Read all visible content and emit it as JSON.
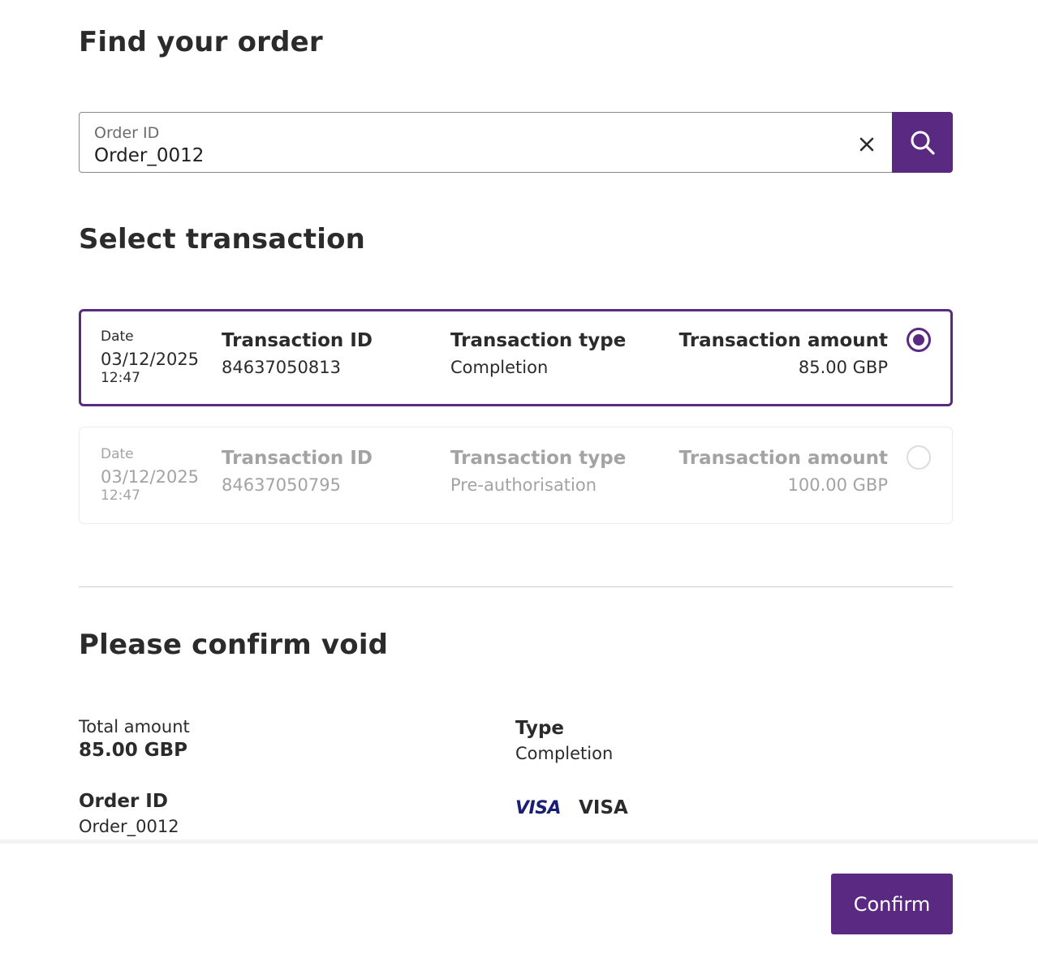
{
  "find_order": {
    "title": "Find your order",
    "field_label": "Order ID",
    "field_value": "Order_0012"
  },
  "select_transaction": {
    "title": "Select transaction",
    "transactions": [
      {
        "date_label": "Date",
        "date": "03/12/2025",
        "time": "12:47",
        "id_label": "Transaction ID",
        "id": "84637050813",
        "type_label": "Transaction type",
        "type": "Completion",
        "amount_label": "Transaction amount",
        "amount": "85.00 GBP",
        "selected": true
      },
      {
        "date_label": "Date",
        "date": "03/12/2025",
        "time": "12:47",
        "id_label": "Transaction ID",
        "id": "84637050795",
        "type_label": "Transaction type",
        "type": "Pre-authorisation",
        "amount_label": "Transaction amount",
        "amount": "100.00 GBP",
        "selected": false
      }
    ]
  },
  "confirm_void": {
    "title": "Please confirm void",
    "total_label": "Total amount",
    "total_value": "85.00 GBP",
    "order_id_label": "Order ID",
    "order_id_value": "Order_0012",
    "type_label": "Type",
    "type_value": "Completion",
    "card_logo": "VISA",
    "card_name": "VISA"
  },
  "footer": {
    "confirm_label": "Confirm"
  },
  "colors": {
    "accent": "#5a2a82",
    "text": "#2b2b2b",
    "muted": "#a3a3a3",
    "visa": "#1a1f71"
  }
}
